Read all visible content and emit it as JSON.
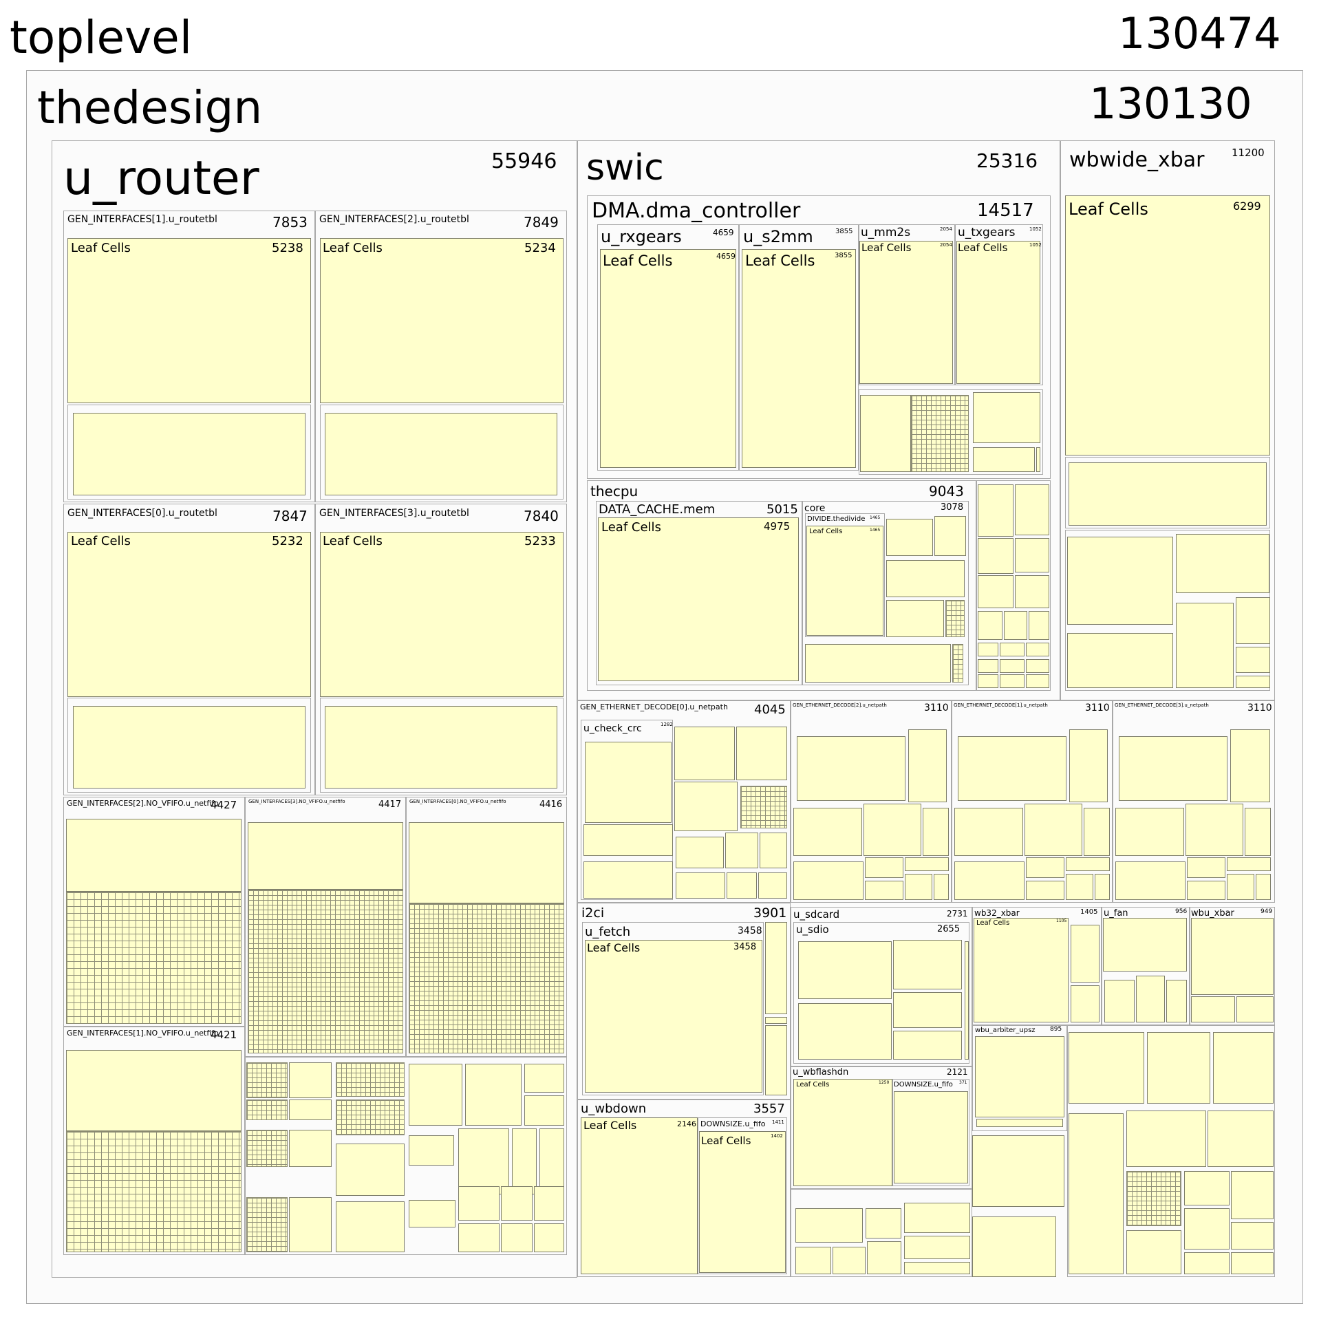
{
  "title": "toplevel",
  "total": "130474",
  "nodes": [
    {
      "name": "thedesign",
      "value": "130130"
    },
    {
      "name": "u_router",
      "value": "55946"
    },
    {
      "name": "GEN_INTERFACES[1].u_routetbl",
      "value": "7853"
    },
    {
      "name": "GEN_INTERFACES[2].u_routetbl",
      "value": "7849"
    },
    {
      "name": "GEN_INTERFACES[0].u_routetbl",
      "value": "7847"
    },
    {
      "name": "GEN_INTERFACES[3].u_routetbl",
      "value": "7840"
    },
    {
      "name": "GEN_INTERFACES[2].NO_VFIFO.u_netfifo",
      "value": "4427"
    },
    {
      "name": "GEN_INTERFACES[3].NO_VFIFO.u_netfifo",
      "value": "4417"
    },
    {
      "name": "GEN_INTERFACES[0].NO_VFIFO.u_netfifo",
      "value": "4416"
    },
    {
      "name": "GEN_INTERFACES[1].NO_VFIFO.u_netfifo",
      "value": "4421"
    },
    {
      "name": "swic",
      "value": "25316"
    },
    {
      "name": "DMA.dma_controller",
      "value": "14517"
    },
    {
      "name": "u_rxgears",
      "value": "4659"
    },
    {
      "name": "u_s2mm",
      "value": "3855"
    },
    {
      "name": "u_mm2s",
      "value": "2054"
    },
    {
      "name": "u_txgears",
      "value": "1052"
    },
    {
      "name": "thecpu",
      "value": "9043"
    },
    {
      "name": "DATA_CACHE.mem",
      "value": "5015"
    },
    {
      "name": "core",
      "value": "3078"
    },
    {
      "name": "DIVIDE.thedivide",
      "value": "1465"
    },
    {
      "name": "wbwide_xbar",
      "value": "11200"
    },
    {
      "name": "GEN_ETHERNET_DECODE[0].u_netpath",
      "value": "4045"
    },
    {
      "name": "u_check_crc",
      "value": "1282"
    },
    {
      "name": "GEN_ETHERNET_DECODE[2].u_netpath",
      "value": "3110"
    },
    {
      "name": "GEN_ETHERNET_DECODE[1].u_netpath",
      "value": "3110"
    },
    {
      "name": "GEN_ETHERNET_DECODE[3].u_netpath",
      "value": "3110"
    },
    {
      "name": "i2ci",
      "value": "3901"
    },
    {
      "name": "u_fetch",
      "value": "3458"
    },
    {
      "name": "u_wbdown",
      "value": "3557"
    },
    {
      "name": "DOWNSIZE.u_fifo",
      "value": "1411"
    },
    {
      "name": "u_sdcard",
      "value": "2731"
    },
    {
      "name": "u_sdio",
      "value": "2655"
    },
    {
      "name": "u_wbflashdn",
      "value": "2121"
    },
    {
      "name": "DOWNSIZE.u_fifo",
      "value": "371"
    },
    {
      "name": "wb32_xbar",
      "value": "1405"
    },
    {
      "name": "u_fan",
      "value": "956"
    },
    {
      "name": "wbu_xbar",
      "value": "949"
    },
    {
      "name": "wbu_arbiter_upsz",
      "value": "895"
    }
  ],
  "leaves": [
    {
      "name": "Leaf Cells",
      "value": "5238"
    },
    {
      "name": "Leaf Cells",
      "value": "5234"
    },
    {
      "name": "Leaf Cells",
      "value": "5232"
    },
    {
      "name": "Leaf Cells",
      "value": "5233"
    },
    {
      "name": "Leaf Cells",
      "value": "4659"
    },
    {
      "name": "Leaf Cells",
      "value": "3855"
    },
    {
      "name": "Leaf Cells",
      "value": "2054"
    },
    {
      "name": "Leaf Cells",
      "value": "1052"
    },
    {
      "name": "Leaf Cells",
      "value": "4975"
    },
    {
      "name": "Leaf Cells",
      "value": "1465"
    },
    {
      "name": "Leaf Cells",
      "value": "6299"
    },
    {
      "name": "Leaf Cells",
      "value": "3458"
    },
    {
      "name": "Leaf Cells",
      "value": "2146"
    },
    {
      "name": "Leaf Cells",
      "value": "1402"
    },
    {
      "name": "Leaf Cells",
      "value": "1250"
    },
    {
      "name": "Leaf Cells",
      "value": "1105"
    }
  ]
}
